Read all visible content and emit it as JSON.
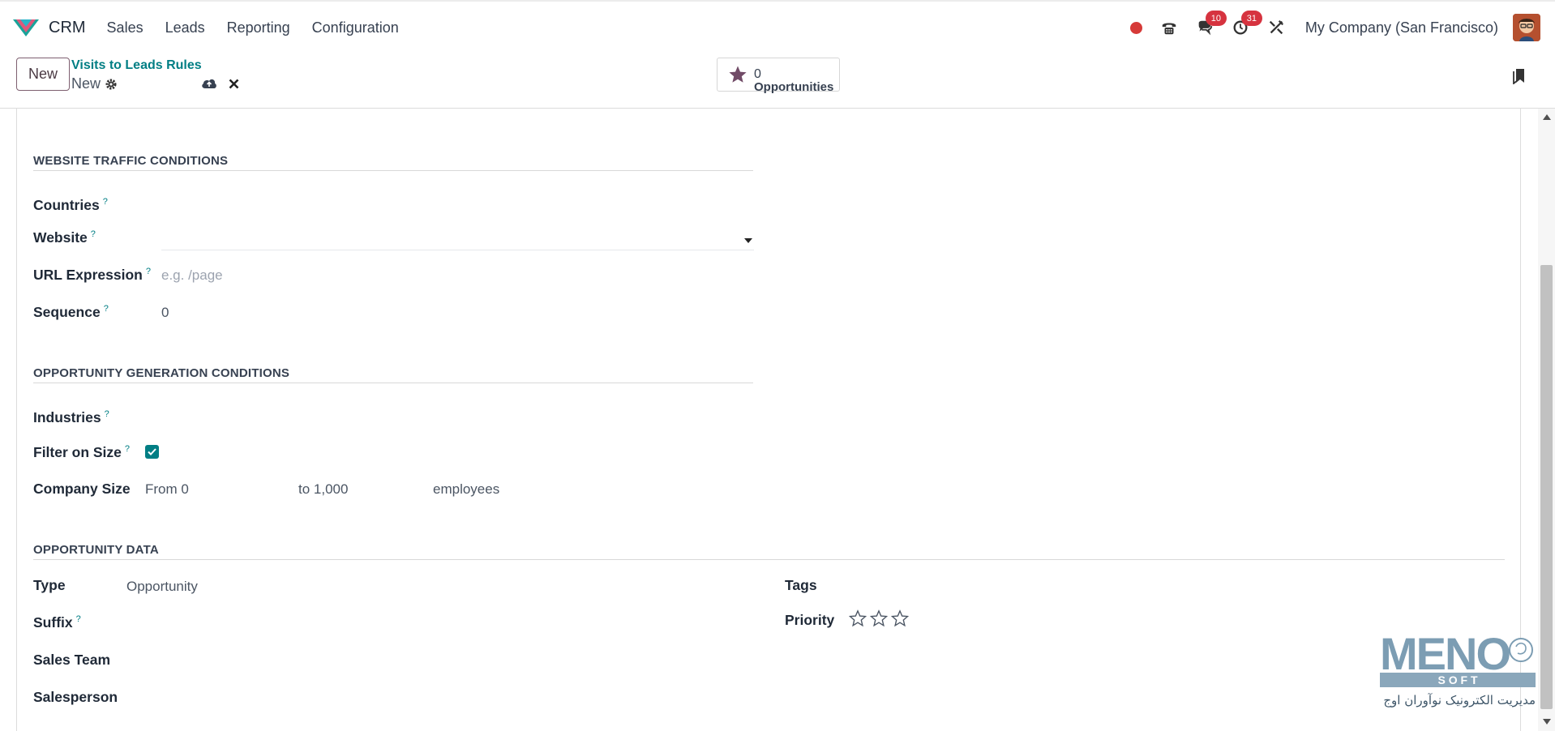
{
  "navbar": {
    "app_name": "CRM",
    "menus": [
      "Sales",
      "Leads",
      "Reporting",
      "Configuration"
    ],
    "messages_badge": "10",
    "activities_badge": "31",
    "company": "My Company (San Francisco)",
    "icons": [
      "recording-dot-icon",
      "phone-icon",
      "chat-icon",
      "clock-icon",
      "tools-icon",
      "user-avatar"
    ]
  },
  "control_panel": {
    "new_button": "New",
    "breadcrumb": "Visits to Leads Rules",
    "record_name": "New",
    "smart_button": {
      "count": "0",
      "label": "Opportunities"
    }
  },
  "form": {
    "website_traffic": {
      "title": "WEBSITE TRAFFIC CONDITIONS",
      "countries_label": "Countries",
      "website_label": "Website",
      "url_label": "URL Expression",
      "url_placeholder": "e.g. /page",
      "sequence_label": "Sequence",
      "sequence_value": "0"
    },
    "opportunity_generation": {
      "title": "OPPORTUNITY GENERATION CONDITIONS",
      "industries_label": "Industries",
      "filter_label": "Filter on Size",
      "filter_checked": true,
      "company_size_label": "Company Size",
      "from_text": "From 0",
      "to_text": "to 1,000",
      "employees_text": "employees"
    },
    "opportunity_data": {
      "title": "OPPORTUNITY DATA",
      "type_label": "Type",
      "type_value": "Opportunity",
      "suffix_label": "Suffix",
      "sales_team_label": "Sales Team",
      "salesperson_label": "Salesperson",
      "tags_label": "Tags",
      "priority_label": "Priority",
      "priority_value": 0,
      "priority_max": 3
    },
    "help_marker": "?"
  },
  "watermark": {
    "brand": "MENO",
    "sub": "S O F T",
    "tagline": "مدیریت الکترونیک نوآوران اوج"
  },
  "colors": {
    "accent": "#017e84",
    "brand": "#714b67",
    "badge": "#d6333f"
  }
}
